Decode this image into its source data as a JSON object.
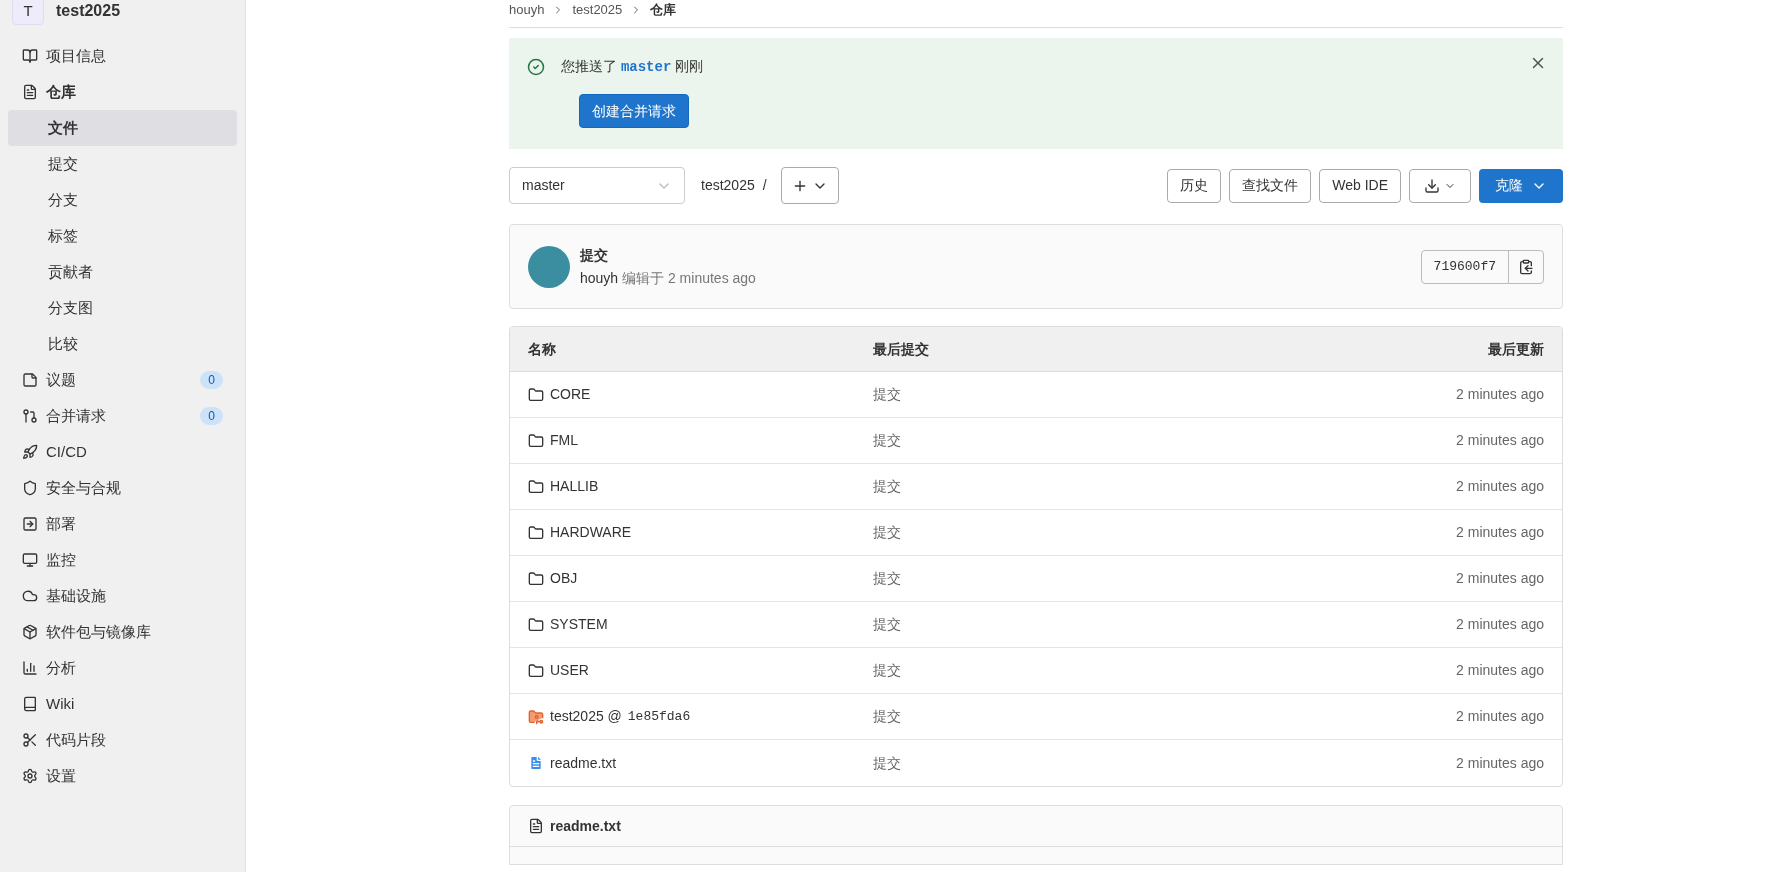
{
  "sidebar": {
    "project": {
      "avatar_letter": "T",
      "name": "test2025"
    },
    "items": [
      {
        "label": "项目信息",
        "selected": false
      },
      {
        "label": "仓库",
        "selected": true,
        "children": [
          {
            "label": "文件",
            "selected": true
          },
          {
            "label": "提交",
            "selected": false
          },
          {
            "label": "分支",
            "selected": false
          },
          {
            "label": "标签",
            "selected": false
          },
          {
            "label": "贡献者",
            "selected": false
          },
          {
            "label": "分支图",
            "selected": false
          },
          {
            "label": "比较",
            "selected": false
          }
        ]
      },
      {
        "label": "议题",
        "selected": false,
        "count": "0"
      },
      {
        "label": "合并请求",
        "selected": false,
        "count": "0"
      },
      {
        "label": "CI/CD",
        "selected": false
      },
      {
        "label": "安全与合规",
        "selected": false
      },
      {
        "label": "部署",
        "selected": false
      },
      {
        "label": "监控",
        "selected": false
      },
      {
        "label": "基础设施",
        "selected": false
      },
      {
        "label": "软件包与镜像库",
        "selected": false
      },
      {
        "label": "分析",
        "selected": false
      },
      {
        "label": "Wiki",
        "selected": false
      },
      {
        "label": "代码片段",
        "selected": false
      },
      {
        "label": "设置",
        "selected": false
      }
    ]
  },
  "breadcrumb": [
    "houyh",
    "test2025",
    "仓库"
  ],
  "alert": {
    "prefix": "您推送了",
    "branch": "master",
    "suffix": "刚刚",
    "button": "创建合并请求"
  },
  "toolbar": {
    "branch": "master",
    "path": "test2025",
    "separator": "/",
    "buttons": [
      "历史",
      "查找文件",
      "Web IDE"
    ],
    "clone": "克隆"
  },
  "commit": {
    "title": "提交",
    "author": "houyh",
    "meta": "编辑于 2 minutes ago",
    "sha": "719600f7"
  },
  "table": {
    "columns": [
      "名称",
      "最后提交",
      "最后更新"
    ],
    "rows": [
      {
        "kind": "folder",
        "name": "CORE",
        "commit": "提交",
        "updated": "2 minutes ago"
      },
      {
        "kind": "folder",
        "name": "FML",
        "commit": "提交",
        "updated": "2 minutes ago"
      },
      {
        "kind": "folder",
        "name": "HALLIB",
        "commit": "提交",
        "updated": "2 minutes ago"
      },
      {
        "kind": "folder",
        "name": "HARDWARE",
        "commit": "提交",
        "updated": "2 minutes ago"
      },
      {
        "kind": "folder",
        "name": "OBJ",
        "commit": "提交",
        "updated": "2 minutes ago"
      },
      {
        "kind": "folder",
        "name": "SYSTEM",
        "commit": "提交",
        "updated": "2 minutes ago"
      },
      {
        "kind": "folder",
        "name": "USER",
        "commit": "提交",
        "updated": "2 minutes ago"
      },
      {
        "kind": "submodule",
        "name": "test2025 @",
        "hash": "1e85fda6",
        "commit": "提交",
        "updated": "2 minutes ago"
      },
      {
        "kind": "file",
        "name": "readme.txt",
        "commit": "提交",
        "updated": "2 minutes ago"
      }
    ]
  },
  "readme": {
    "title": "readme.txt"
  }
}
